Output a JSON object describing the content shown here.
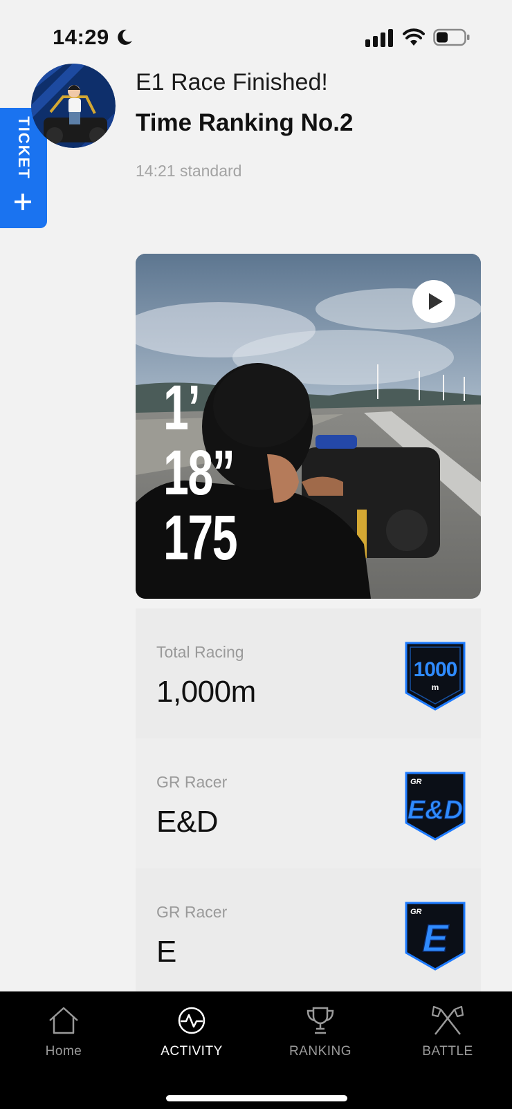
{
  "status_bar": {
    "time": "14:29"
  },
  "ticket": {
    "label": "TICKET",
    "icon": "plus-icon"
  },
  "header": {
    "subtitle": "E1 Race Finished!",
    "title": "Time Ranking No.2",
    "meta": "14:21 standard"
  },
  "video": {
    "lap_minutes": "1’",
    "lap_seconds": "18”",
    "lap_millis": "175",
    "play_icon": "play-icon"
  },
  "stats": [
    {
      "label": "Total Racing",
      "value": "1,000m",
      "badge": "distance-1000m-badge",
      "badge_text": "1000",
      "badge_unit": "m"
    },
    {
      "label": "GR Racer",
      "value": "E&D",
      "badge": "gr-racer-ed-badge",
      "badge_text": "E&D"
    },
    {
      "label": "GR Racer",
      "value": "E",
      "badge": "gr-racer-e-badge",
      "badge_text": "E"
    }
  ],
  "nav": {
    "items": [
      {
        "label": "Home",
        "icon": "home-icon",
        "active": false
      },
      {
        "label": "ACTIVITY",
        "icon": "activity-icon",
        "active": true
      },
      {
        "label": "RANKING",
        "icon": "trophy-icon",
        "active": false
      },
      {
        "label": "BATTLE",
        "icon": "crossed-flags-icon",
        "active": false
      }
    ]
  },
  "colors": {
    "accent": "#1a73f0",
    "badge_blue": "#1e7bff",
    "nav_bg": "#000000"
  }
}
